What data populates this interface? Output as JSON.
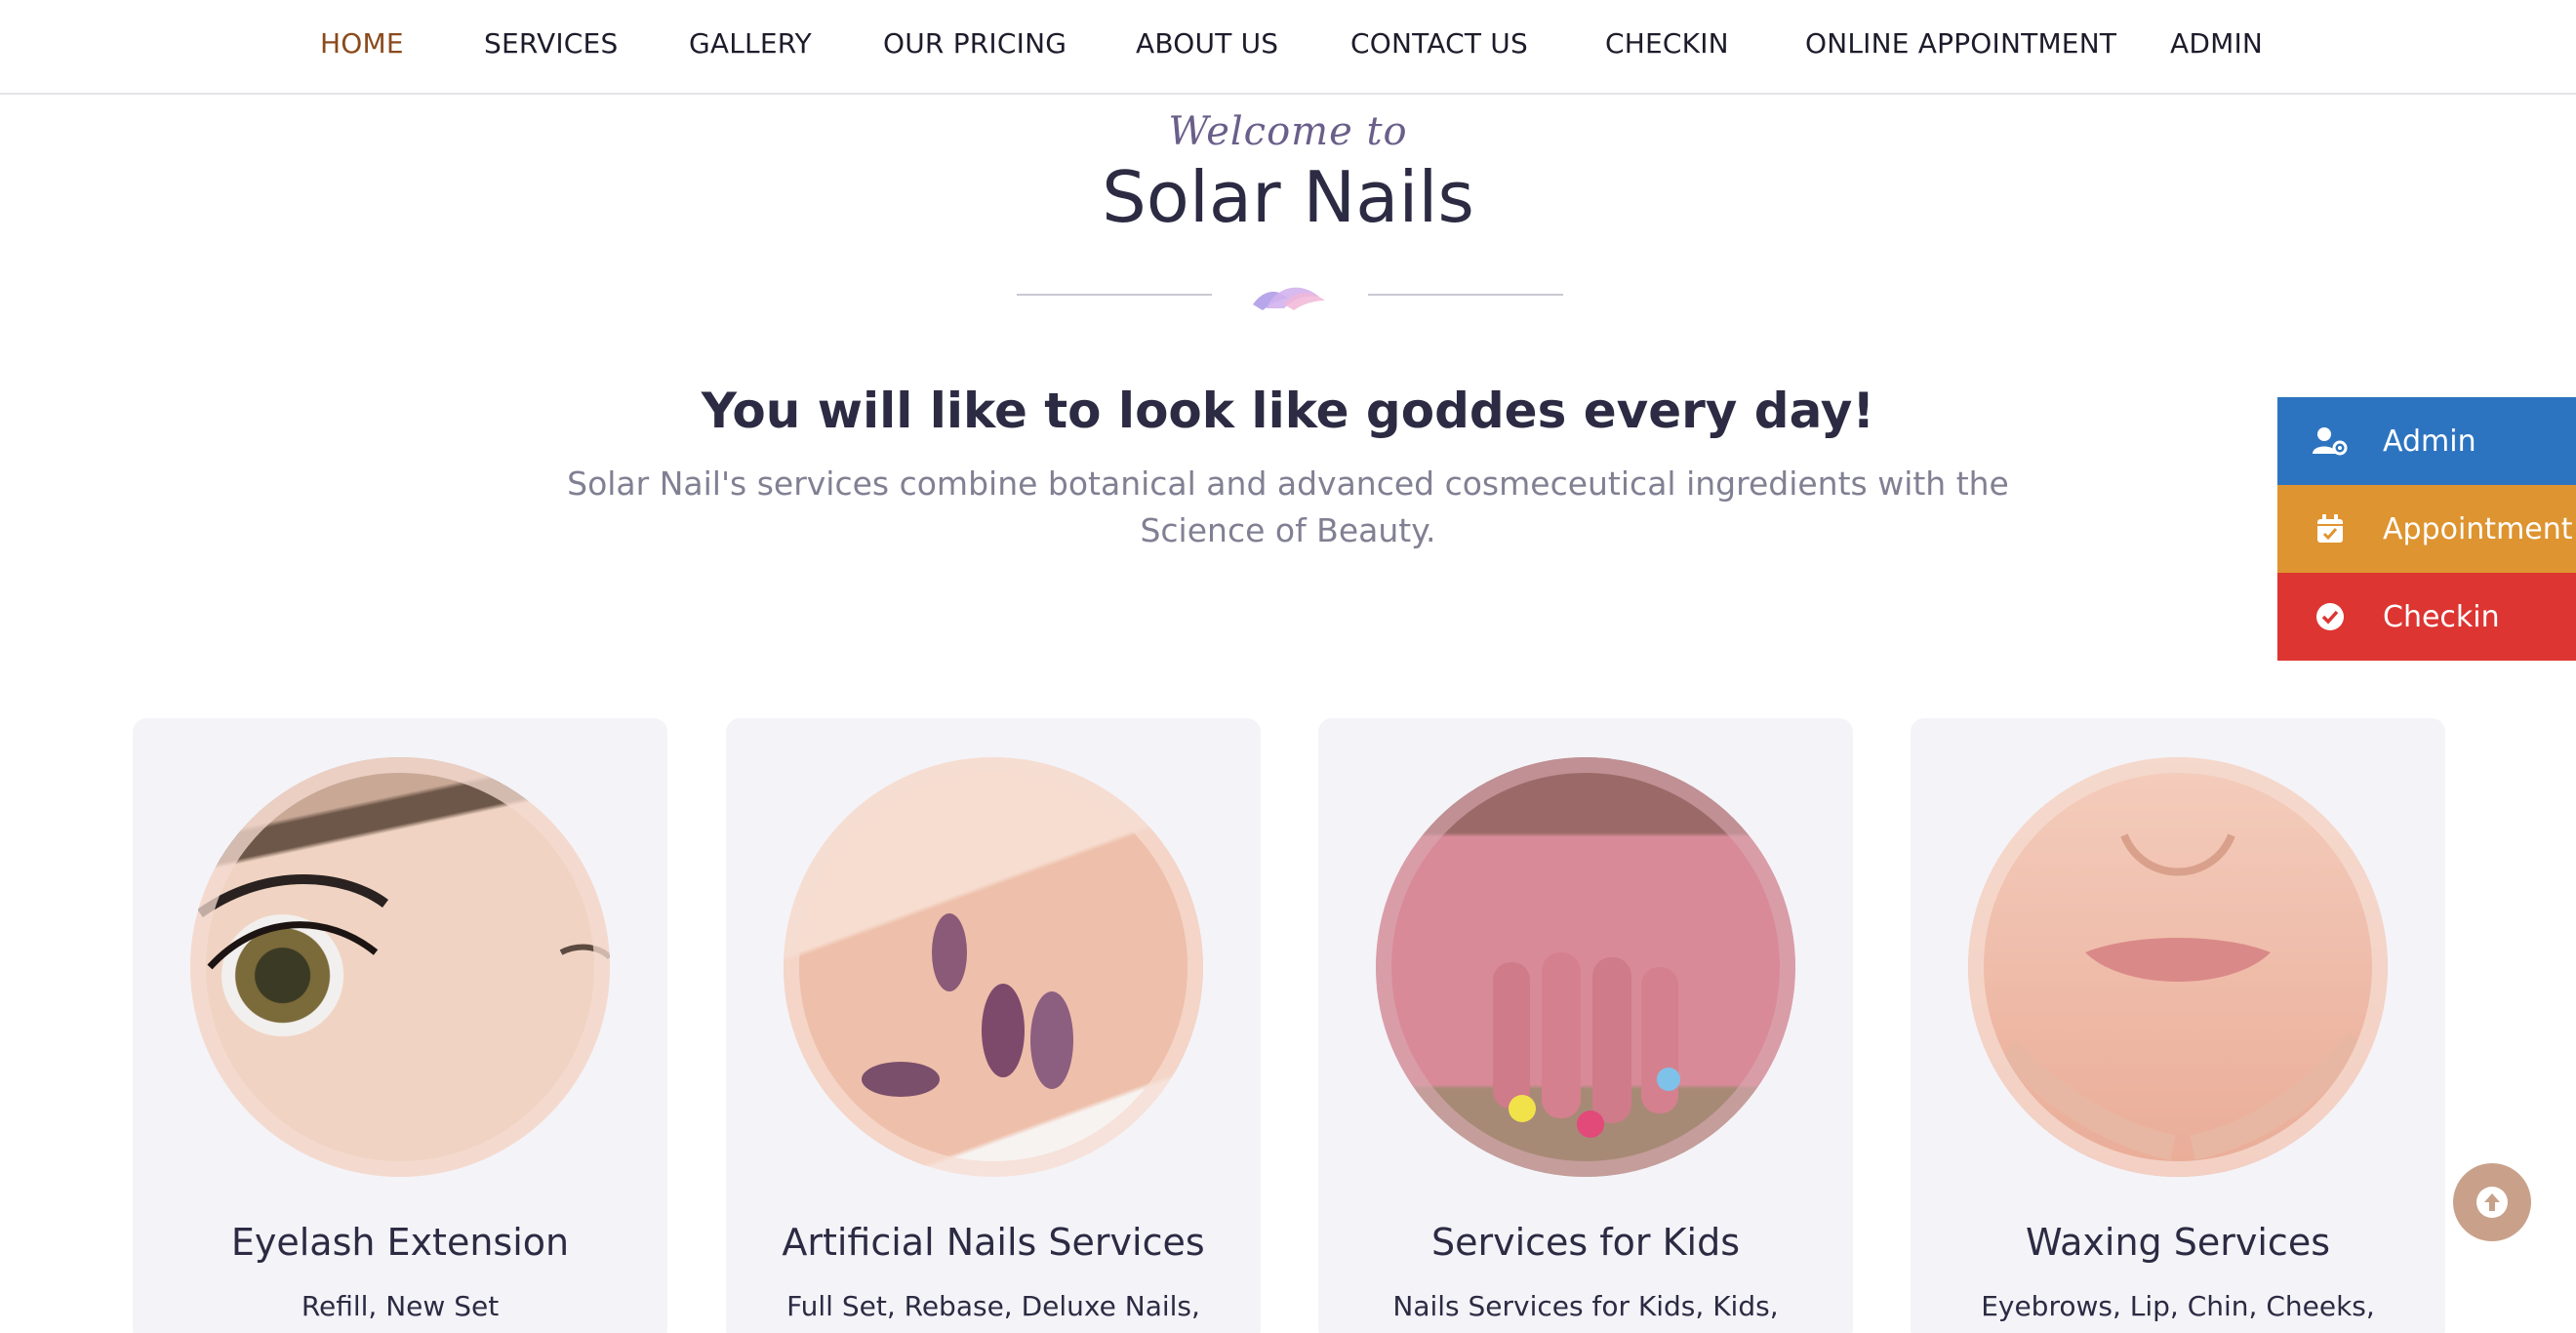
{
  "nav": {
    "items": [
      {
        "label": "HOME",
        "active": true
      },
      {
        "label": "SERVICES"
      },
      {
        "label": "GALLERY"
      },
      {
        "label": "OUR PRICING"
      },
      {
        "label": "ABOUT US"
      },
      {
        "label": "CONTACT US"
      },
      {
        "label": "CHECKIN"
      },
      {
        "label": "ONLINE APPOINTMENT"
      },
      {
        "label": "ADMIN"
      }
    ]
  },
  "hero": {
    "welcome": "Welcome to",
    "brand": "Solar Nails",
    "tagline": "You will like to look like goddes every day!",
    "description": "Solar Nail's services combine botanical and advanced cosmeceutical ingredients with the Science of Beauty."
  },
  "side_buttons": {
    "admin": {
      "label": "Admin",
      "icon": "user-gear-icon",
      "color": "#2d74c0"
    },
    "appointment": {
      "label": "Appointment",
      "icon": "calendar-check-icon",
      "color": "#de9430"
    },
    "checkin": {
      "label": "Checkin",
      "icon": "check-circle-icon",
      "color": "#dd3532"
    }
  },
  "services": [
    {
      "title": "Eyelash Extension",
      "subtitle": "Refill, New Set"
    },
    {
      "title": "Artificial Nails Services",
      "subtitle": "Full Set, Rebase, Deluxe Nails,"
    },
    {
      "title": "Services for Kids",
      "subtitle": "Nails Services for Kids, Kids,"
    },
    {
      "title": "Waxing Services",
      "subtitle": "Eyebrows, Lip, Chin, Cheeks,"
    }
  ],
  "colors": {
    "accent": "#8a4a1c",
    "card_bg": "#f4f3f8",
    "back_to_top": "#c9a18a"
  },
  "back_to_top": {
    "icon": "arrow-up-icon"
  }
}
